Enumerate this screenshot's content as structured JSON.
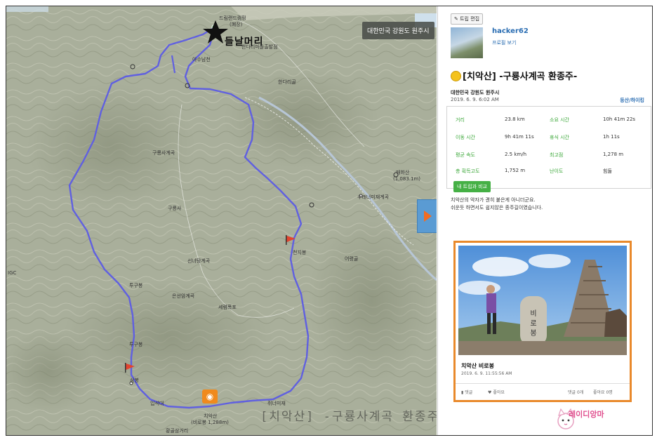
{
  "map": {
    "region_button": "대한민국 강원도 원주시",
    "handwritten_label": "들날머리",
    "watermark": "[치악산] -구룡사계곡 환종주-",
    "places": [
      {
        "id": "p1",
        "text": "드림랜드캠핑"
      },
      {
        "id": "p2",
        "text": "(폐장)"
      },
      {
        "id": "p3",
        "text": "한다리마을출발점"
      },
      {
        "id": "p4",
        "text": "아수남천"
      },
      {
        "id": "p5",
        "text": "한다리골"
      },
      {
        "id": "p6",
        "text": "구룡사계곡"
      },
      {
        "id": "p7",
        "text": "구룡사"
      },
      {
        "id": "p8",
        "text": "선녀탕계곡"
      },
      {
        "id": "p9",
        "text": "은선암계곡"
      },
      {
        "id": "p10",
        "text": "세렴폭포"
      },
      {
        "id": "p11",
        "text": "매화산"
      },
      {
        "id": "p12",
        "text": "(1,083.1m)"
      },
      {
        "id": "p13",
        "text": "수레너미재계곡"
      },
      {
        "id": "p14",
        "text": "천지봉"
      },
      {
        "id": "p15",
        "text": "어령골"
      },
      {
        "id": "p16",
        "text": "투구봉"
      },
      {
        "id": "p17",
        "text": "투구봉"
      },
      {
        "id": "p18",
        "text": "삼봉"
      },
      {
        "id": "p19",
        "text": "치악산"
      },
      {
        "id": "p20",
        "text": "(비로봉 1,288m)"
      },
      {
        "id": "p21",
        "text": "황골삼거리"
      },
      {
        "id": "p22",
        "text": "입석대"
      },
      {
        "id": "p23",
        "text": "쥐너미재"
      },
      {
        "id": "p24",
        "text": "IGC"
      }
    ]
  },
  "panel": {
    "edit_button": "트립 편집",
    "username": "hacker62",
    "profile_link": "프로필 보기",
    "trip_title": "[치악산] -구룡사계곡 환종주-",
    "location": "대한민국 강원도 원주시",
    "date": "2019. 6. 9. 6:02 AM",
    "category": "등산/하이킹",
    "stats": {
      "distance_label": "거리",
      "distance": "23.8 km",
      "total_time_label": "소요 시간",
      "total_time": "10h 41m 22s",
      "moving_time_label": "이동 시간",
      "moving_time": "9h 41m 11s",
      "rest_time_label": "휴식 시간",
      "rest_time": "1h 11s",
      "avg_speed_label": "평균 속도",
      "avg_speed": "2.5 km/h",
      "max_alt_label": "최고점",
      "max_alt": "1,278 m",
      "total_ascent_label": "총 획득고도",
      "total_ascent": "1,752 m",
      "difficulty_label": "난이도",
      "difficulty": "힘듦"
    },
    "compare_button": "내 트립과 비교",
    "description_line1": "치악산의 악자가 괜히 붙은게 아니더군요.",
    "description_line2": "쉬운듯 하면서도 쉽지않은 종주길이였습니다.",
    "photo": {
      "sign_text": "비로봉",
      "title": "치악산 비로봉",
      "time": "2019. 6. 9. 11:55:56 AM",
      "comment_label": "댓글",
      "like_label": "좋아요",
      "comment_count": "댓글 0개",
      "like_count": "좋아요 0명"
    },
    "stamp": "레이디앙마"
  },
  "colors": {
    "route": "#5b5bd6",
    "accent_orange": "#e9892b",
    "stat_green": "#38a636",
    "link_blue": "#2a6db2"
  }
}
